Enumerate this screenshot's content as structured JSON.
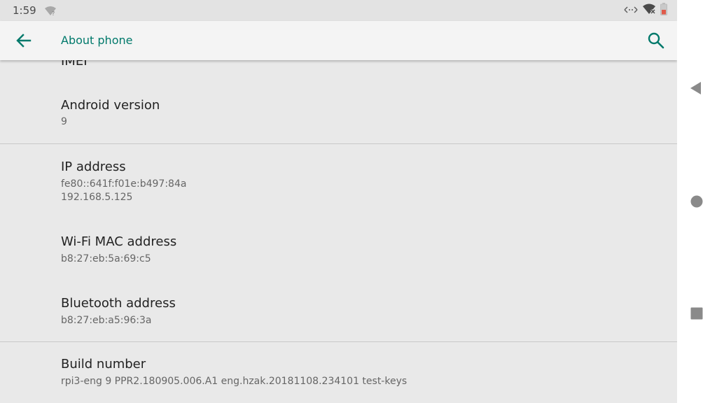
{
  "status_bar": {
    "time": "1:59"
  },
  "app_bar": {
    "title": "About phone"
  },
  "list": {
    "partial_item_title": "IMEI",
    "items": [
      {
        "title": "Android version",
        "subtitle": "9"
      },
      {
        "title": "IP address",
        "subtitle": "fe80::641f:f01e:b497:84a\n192.168.5.125"
      },
      {
        "title": "Wi-Fi MAC address",
        "subtitle": "b8:27:eb:5a:69:c5"
      },
      {
        "title": "Bluetooth address",
        "subtitle": "b8:27:eb:a5:96:3a"
      },
      {
        "title": "Build number",
        "subtitle": "rpi3-eng 9 PPR2.180905.006.A1 eng.hzak.20181108.234101 test-keys"
      }
    ]
  },
  "colors": {
    "accent": "#00796b",
    "background": "#e9e9e9",
    "app_bar": "#f4f4f4",
    "status_bar": "#e3e3e3"
  },
  "icons": [
    "wifi-question-icon",
    "data-sync-icon",
    "wifi-off-icon",
    "battery-low-icon",
    "back-arrow-icon",
    "search-icon",
    "nav-back-icon",
    "nav-home-icon",
    "nav-recents-icon"
  ]
}
